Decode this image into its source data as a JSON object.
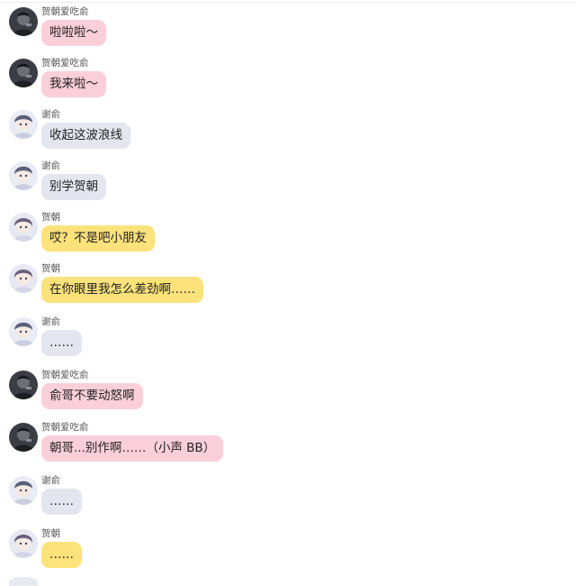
{
  "chat": {
    "messages": [
      {
        "sender": "贺朝爱吃俞",
        "text": "啦啦啦～",
        "bubble_color": "#fbcfd9",
        "avatar": "dark-avatar"
      },
      {
        "sender": "贺朝爱吃俞",
        "text": "我来啦～",
        "bubble_color": "#fbcfd9",
        "avatar": "dark-avatar"
      },
      {
        "sender": "谢俞",
        "text": "收起这波浪线",
        "bubble_color": "#e3e6ee",
        "avatar": "anime-avatar"
      },
      {
        "sender": "谢俞",
        "text": "别学贺朝",
        "bubble_color": "#e3e6ee",
        "avatar": "anime-avatar"
      },
      {
        "sender": "贺朝",
        "text": "哎？不是吧小朋友",
        "bubble_color": "#fce27a",
        "avatar": "anime-avatar"
      },
      {
        "sender": "贺朝",
        "text": "在你眼里我怎么差劲啊……",
        "bubble_color": "#fce27a",
        "avatar": "anime-avatar"
      },
      {
        "sender": "谢俞",
        "text": "……",
        "bubble_color": "#e3e6ee",
        "avatar": "anime-avatar"
      },
      {
        "sender": "贺朝爱吃俞",
        "text": "俞哥不要动怒啊",
        "bubble_color": "#fbcfd9",
        "avatar": "dark-avatar"
      },
      {
        "sender": "贺朝爱吃俞",
        "text": "朝哥...别作啊……（小声 BB）",
        "bubble_color": "#fbcfd9",
        "avatar": "dark-avatar"
      },
      {
        "sender": "谢俞",
        "text": "……",
        "bubble_color": "#e3e6ee",
        "avatar": "anime-avatar"
      },
      {
        "sender": "贺朝",
        "text": "……",
        "bubble_color": "#fce27a",
        "avatar": "anime-avatar"
      }
    ]
  }
}
